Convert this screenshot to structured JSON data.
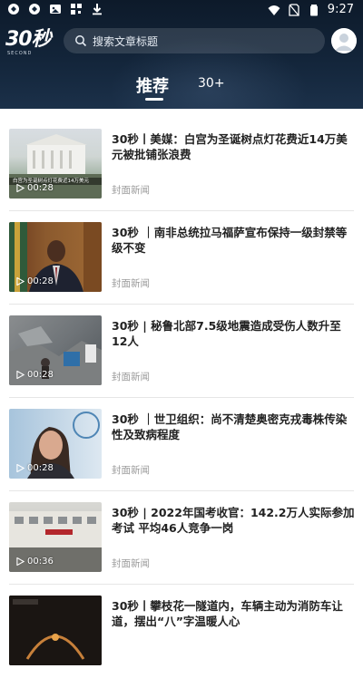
{
  "status_bar": {
    "time": "9:27"
  },
  "header": {
    "logo_text": "30秒",
    "logo_sub": "SECOND",
    "search_placeholder": "搜索文章标题",
    "tabs": [
      {
        "label": "推荐"
      },
      {
        "label": "30+"
      }
    ]
  },
  "articles": [
    {
      "title": "30秒丨美媒：白宫为圣诞树点灯花费近14万美元被批铺张浪费",
      "source": "封面新闻",
      "duration": "00:28",
      "thumb_caption": "白宫为圣诞树点灯花费近14万美元"
    },
    {
      "title": "30秒 ｜南非总统拉马福萨宣布保持一级封禁等级不变",
      "source": "封面新闻",
      "duration": "00:28"
    },
    {
      "title": "30秒 | 秘鲁北部7.5级地震造成受伤人数升至12人",
      "source": "封面新闻",
      "duration": "00:28"
    },
    {
      "title": "30秒 ｜世卫组织：尚不清楚奥密克戎毒株传染性及致病程度",
      "source": "封面新闻",
      "duration": "00:28"
    },
    {
      "title": "30秒 | 2022年国考收官：142.2万人实际参加考试 平均46人竞争一岗",
      "source": "封面新闻",
      "duration": "00:36"
    },
    {
      "title": "30秒丨攀枝花一隧道内，车辆主动为消防车让道，摆出“八”字温暖人心",
      "source": "",
      "duration": ""
    }
  ]
}
